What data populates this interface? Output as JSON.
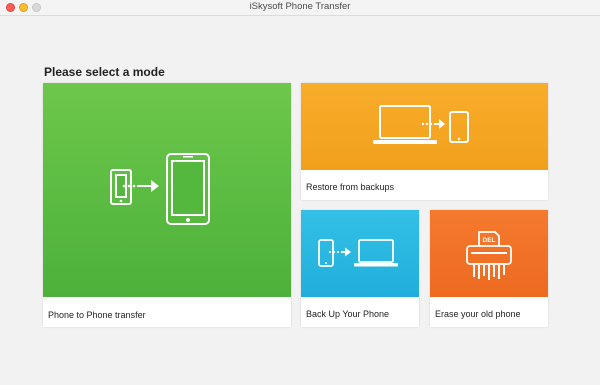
{
  "window": {
    "title": "iSkysoft Phone Transfer"
  },
  "heading": "Please select a mode",
  "modes": [
    {
      "label": "Phone to Phone transfer",
      "color": "#55b83e",
      "icon": "phone-to-phone-icon"
    },
    {
      "label": "Restore from backups",
      "color": "#f5a623",
      "icon": "laptop-to-phone-icon"
    },
    {
      "label": "Back Up Your Phone",
      "color": "#29b6e0",
      "icon": "phone-to-laptop-icon"
    },
    {
      "label": "Erase your old phone",
      "color": "#f0722a",
      "icon": "shredder-icon"
    }
  ],
  "erase_badge": "DEL"
}
